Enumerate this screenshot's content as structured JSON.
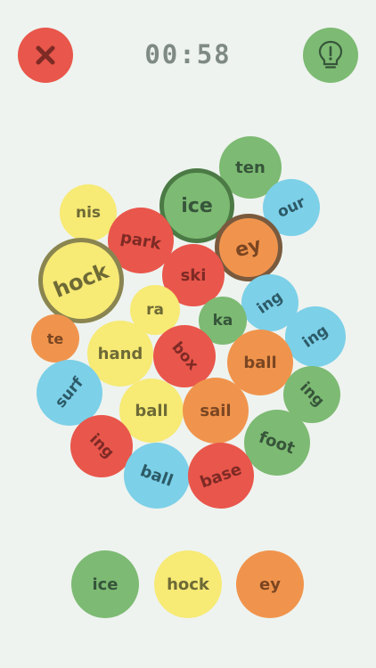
{
  "header": {
    "timer": "00:58",
    "close_icon": "close-x-icon",
    "hint_icon": "lightbulb-icon"
  },
  "colors": {
    "green": "#7dba73",
    "blue": "#7cd0e8",
    "red": "#e9564b",
    "orange": "#f0944d",
    "yellow": "#f7ea75",
    "background": "#eef3ef"
  },
  "bubbles": [
    {
      "label": "ten",
      "color": "green",
      "selected": false
    },
    {
      "label": "ice",
      "color": "green",
      "selected": true
    },
    {
      "label": "our",
      "color": "blue",
      "selected": false
    },
    {
      "label": "nis",
      "color": "yellow",
      "selected": false
    },
    {
      "label": "park",
      "color": "red",
      "selected": false
    },
    {
      "label": "ey",
      "color": "orange",
      "selected": true
    },
    {
      "label": "hock",
      "color": "yellow",
      "selected": true
    },
    {
      "label": "ski",
      "color": "red",
      "selected": false
    },
    {
      "label": "ing",
      "color": "blue",
      "selected": false
    },
    {
      "label": "ra",
      "color": "yellow",
      "selected": false
    },
    {
      "label": "ka",
      "color": "green",
      "selected": false
    },
    {
      "label": "ing",
      "color": "blue",
      "selected": false
    },
    {
      "label": "te",
      "color": "orange",
      "selected": false
    },
    {
      "label": "hand",
      "color": "yellow",
      "selected": false
    },
    {
      "label": "box",
      "color": "red",
      "selected": false
    },
    {
      "label": "ball",
      "color": "orange",
      "selected": false
    },
    {
      "label": "surf",
      "color": "blue",
      "selected": false
    },
    {
      "label": "ing",
      "color": "green",
      "selected": false
    },
    {
      "label": "ball",
      "color": "yellow",
      "selected": false
    },
    {
      "label": "sail",
      "color": "orange",
      "selected": false
    },
    {
      "label": "foot",
      "color": "green",
      "selected": false
    },
    {
      "label": "ing",
      "color": "red",
      "selected": false
    },
    {
      "label": "ball",
      "color": "blue",
      "selected": false
    },
    {
      "label": "base",
      "color": "red",
      "selected": false
    }
  ],
  "tray": [
    {
      "label": "ice",
      "color": "green"
    },
    {
      "label": "hock",
      "color": "yellow"
    },
    {
      "label": "ey",
      "color": "orange"
    }
  ]
}
